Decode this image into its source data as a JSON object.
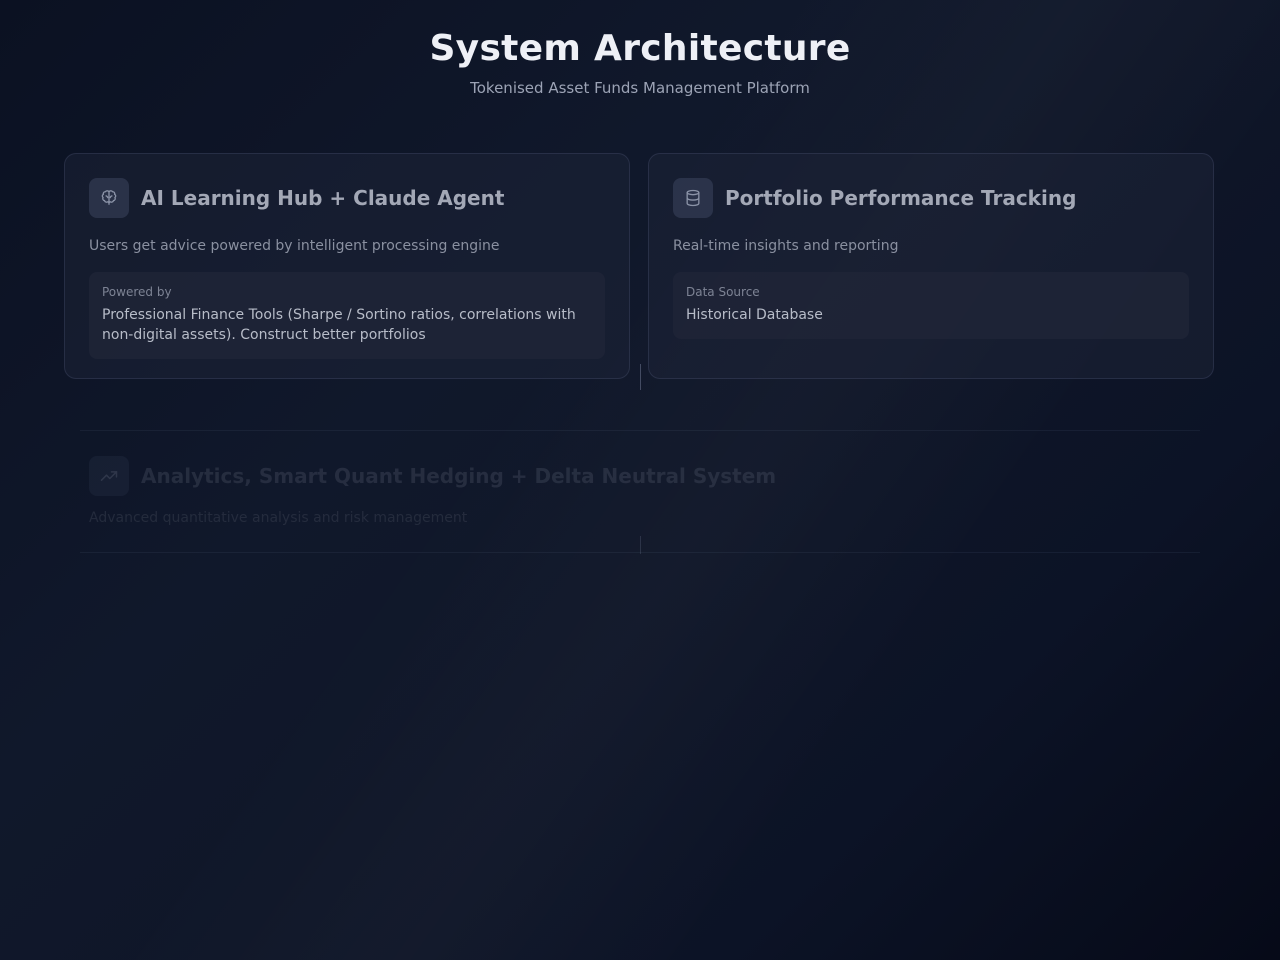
{
  "header": {
    "title": "System Architecture",
    "subtitle": "Tokenised Asset Funds Management Platform"
  },
  "cards": [
    {
      "icon": "brain-icon",
      "title": "AI Learning Hub + Claude Agent",
      "description": "Users get advice powered by intelligent processing engine",
      "detail_label": "Powered by",
      "detail_value": "Professional Finance Tools (Sharpe / Sortino ratios, correlations with non-digital assets). Construct better portfolios"
    },
    {
      "icon": "database-icon",
      "title": "Portfolio Performance Tracking",
      "description": "Real-time insights and reporting",
      "detail_label": "Data Source",
      "detail_value": "Historical Database"
    }
  ],
  "analytics": {
    "icon": "trending-up-icon",
    "title": "Analytics, Smart Quant Hedging + Delta Neutral System",
    "description": "Advanced quantitative analysis and risk management"
  },
  "colors": {
    "background": "#0f1628",
    "card_background": "#1e263a",
    "title_text": "#eef0f6",
    "muted_text": "#9ca3b5"
  }
}
